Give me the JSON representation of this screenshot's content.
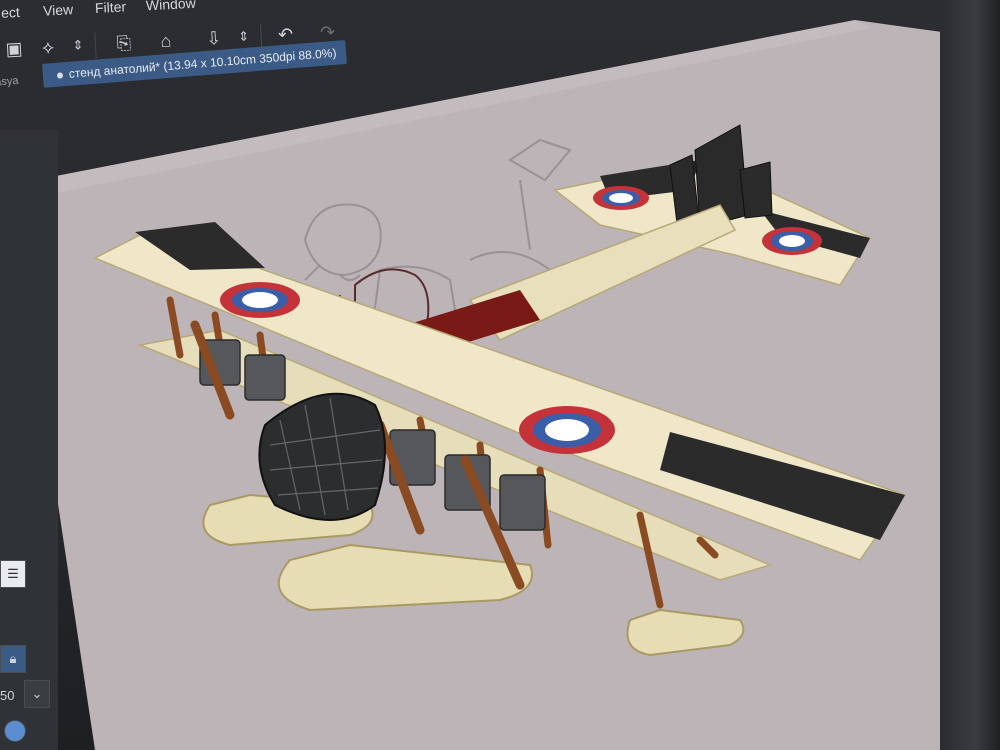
{
  "menu": {
    "items": [
      "ect",
      "View",
      "Filter",
      "Window"
    ]
  },
  "toolbar": {
    "icons": [
      "select-layer-icon",
      "transform-icon",
      "new-document-icon",
      "open-folder-icon",
      "save-icon",
      "undo-icon",
      "redo-icon"
    ]
  },
  "tabs": {
    "left_label": "asya",
    "document_tab": "стенд анатолий* (13.94 x 10.10cm 350dpi 88.0%)"
  },
  "leftpanel": {
    "value": "50"
  },
  "colors": {
    "canvas": "#b9b2b6",
    "wing": "#efe7c7",
    "roundel_red": "#c4323a",
    "roundel_blue": "#3a5ea8",
    "fuselage_red": "#7a1a16"
  }
}
